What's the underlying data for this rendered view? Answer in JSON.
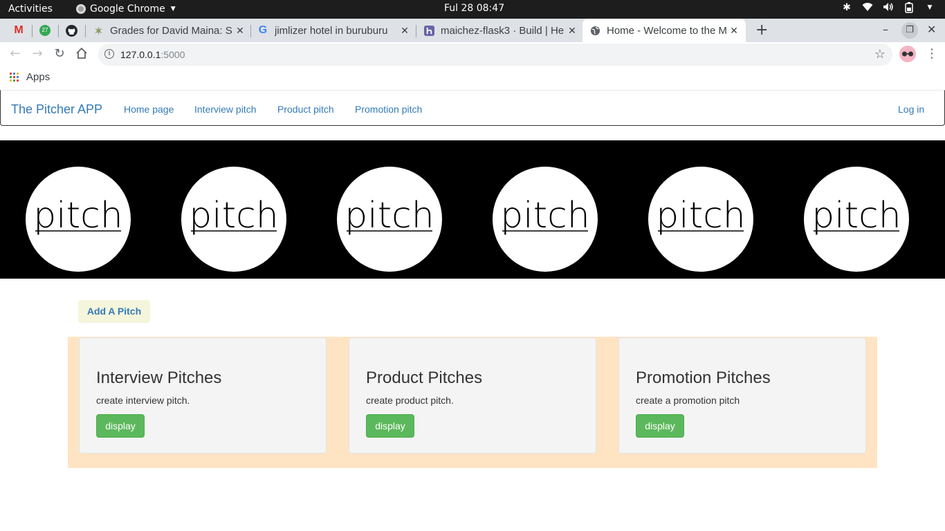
{
  "system_bar": {
    "activities": "Activities",
    "app_name": "Google Chrome",
    "clock": "Ful 28  08:47"
  },
  "browser": {
    "pinned_tabs": [
      {
        "icon": "gmail-icon",
        "label": "M",
        "color": "#d93025"
      },
      {
        "icon": "notification-icon",
        "label": "27",
        "color": "#34a853"
      },
      {
        "icon": "github-icon",
        "label": "",
        "color": "#24292e"
      }
    ],
    "tabs": [
      {
        "title": "Grades for David Maina: S",
        "icon": "canvas-icon"
      },
      {
        "title": "jimlizer hotel in buruburu",
        "icon": "google-icon"
      },
      {
        "title": "maichez-flask3 · Build | He",
        "icon": "heroku-icon"
      },
      {
        "title": "Home - Welcome to the M",
        "icon": "globe-icon",
        "active": true
      }
    ],
    "new_tab_symbol": "+",
    "url_host": "127.0.0.1",
    "url_port": ":5000",
    "bookmarks": {
      "apps_label": "Apps"
    }
  },
  "app": {
    "brand": "The Pitcher APP",
    "nav": [
      "Home page",
      "Interview pitch",
      "Product pitch",
      "Promotion pitch"
    ],
    "login": "Log in",
    "banner_logo_text": "pitch",
    "add_button": "Add A Pitch",
    "cards": [
      {
        "title": "Interview Pitches",
        "desc": "create interview pitch.",
        "button": "display"
      },
      {
        "title": "Product Pitches",
        "desc": "create product pitch.",
        "button": "display"
      },
      {
        "title": "Promotion Pitches",
        "desc": "create a promotion pitch",
        "button": "display"
      }
    ],
    "colors": {
      "link": "#337ab7",
      "banner": "#000000",
      "card_band": "#ffe4c4",
      "card_bg": "#f4f4f4",
      "success": "#5cb85c",
      "add_button_bg": "#f5f5dc"
    }
  }
}
